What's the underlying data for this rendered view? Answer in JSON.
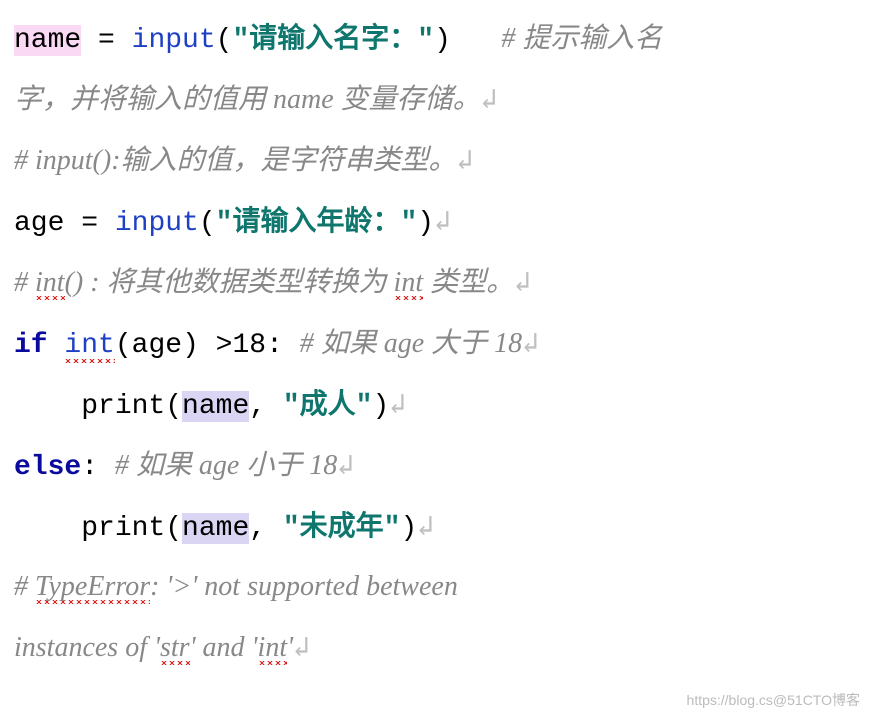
{
  "code": {
    "line1": {
      "name": "name",
      "eq": " = ",
      "input": "input",
      "lp": "(",
      "str": "\"请输入名字：\"",
      "rp": ")",
      "sp": "   ",
      "cmt_head": "# 提示输入名"
    },
    "line2": {
      "cmt": "字，并将输入的值用 name 变量存储。",
      "nl": "↲"
    },
    "line3": {
      "cmt": "# input():输入的值，是字符串类型。",
      "nl": "↲"
    },
    "line4": {
      "age": "age",
      "eq": " = ",
      "input": "input",
      "lp": "(",
      "str": "\"请输入年龄：\"",
      "rp": ")",
      "nl": "↲"
    },
    "line5": {
      "cmt_a": "# ",
      "int": "int",
      "cmt_b": "() : 将其他数据类型转换为 ",
      "int2": "int",
      "cmt_c": " 类型。",
      "nl": "↲"
    },
    "line6": {
      "if": "if",
      "sp": " ",
      "int": "int",
      "lp": "(",
      "age": "age",
      "rp": ") >",
      "num": "18",
      "colon": ": ",
      "cmt": "# 如果 age 大于 18",
      "nl": "↲"
    },
    "line7": {
      "indent": "    ",
      "print": "print",
      "lp": "(",
      "name": "name",
      "comma": ", ",
      "str": "\"成人\"",
      "rp": ")",
      "nl": "↲"
    },
    "line8": {
      "else": "else",
      "colon": ": ",
      "cmt": "# 如果 age 小于 18",
      "nl": "↲"
    },
    "line9": {
      "indent": "    ",
      "print": "print",
      "lp": "(",
      "name": "name",
      "comma": ", ",
      "str": "\"未成年\"",
      "rp": ")",
      "nl": "↲"
    },
    "line10": {
      "cmt_a": "# ",
      "te": "TypeError",
      "cmt_b": ": '>' not supported between "
    },
    "line11": {
      "cmt_a": "instances of '",
      "str": "str",
      "cmt_b": "' and '",
      "int": "int",
      "cmt_c": "'",
      "nl": "↲"
    }
  },
  "watermark": "https://blog.cs@51CTO博客"
}
